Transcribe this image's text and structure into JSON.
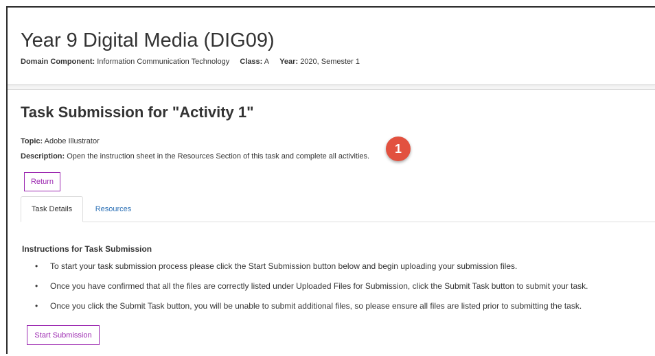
{
  "course": {
    "title": "Year 9 Digital Media (DIG09)",
    "domain_label": "Domain Component:",
    "domain_value": "Information Communication Technology",
    "class_label": "Class:",
    "class_value": "A",
    "year_label": "Year:",
    "year_value": "2020, Semester 1"
  },
  "task": {
    "title": "Task Submission for \"Activity 1\"",
    "topic_label": "Topic:",
    "topic_value": "Adobe Illustrator",
    "description_label": "Description:",
    "description_value": "Open the instruction sheet in the Resources Section of this task and complete all activities.",
    "annotation_badge": "1",
    "return_label": "Return"
  },
  "tabs": [
    {
      "label": "Task Details",
      "active": true
    },
    {
      "label": "Resources",
      "active": false
    }
  ],
  "instructions": {
    "heading": "Instructions for Task Submission",
    "bullet_char": "•",
    "items": [
      "To start your task submission process please click the Start Submission button below and begin uploading your submission files.",
      "Once you have confirmed that all the files are correctly listed under Uploaded Files for Submission, click the Submit Task button to submit your task.",
      "Once you click the Submit Task button, you will be unable to submit additional files, so please ensure all files are listed prior to submitting the task."
    ],
    "start_label": "Start Submission"
  },
  "colors": {
    "accent_purple": "#9b27b0",
    "link_blue": "#2a6fb5",
    "badge_red": "#e2513f"
  }
}
